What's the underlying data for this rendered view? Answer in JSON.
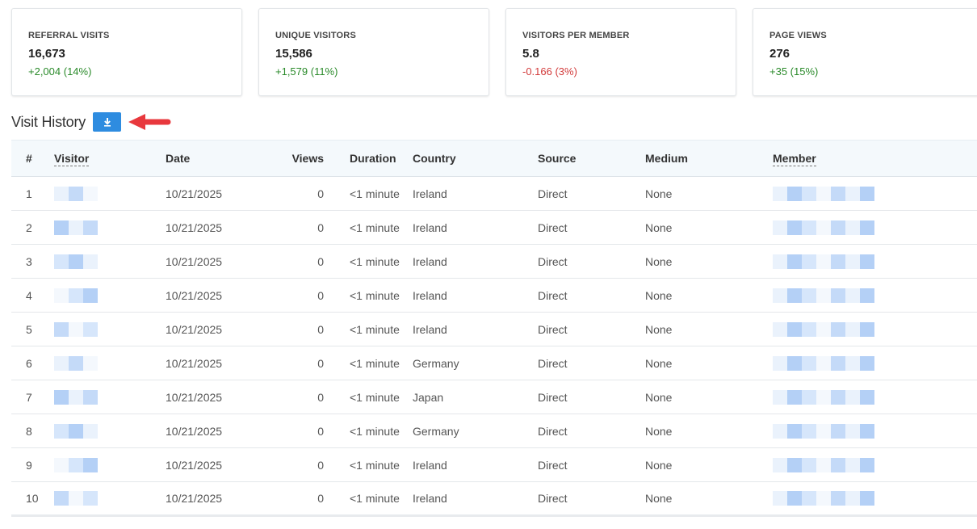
{
  "stats": [
    {
      "label": "REFERRAL VISITS",
      "value": "16,673",
      "change": "+2,004 (14%)",
      "trend": "positive"
    },
    {
      "label": "UNIQUE VISITORS",
      "value": "15,586",
      "change": "+1,579 (11%)",
      "trend": "positive"
    },
    {
      "label": "VISITORS PER MEMBER",
      "value": "5.8",
      "change": "-0.166 (3%)",
      "trend": "negative"
    },
    {
      "label": "PAGE VIEWS",
      "value": "276",
      "change": "+35 (15%)",
      "trend": "positive"
    }
  ],
  "section": {
    "title": "Visit History",
    "download_icon": "download-icon",
    "annotation_icon": "red-arrow-icon"
  },
  "table": {
    "headers": [
      "#",
      "Visitor",
      "Date",
      "Views",
      "Duration",
      "Country",
      "Source",
      "Medium",
      "Member"
    ],
    "rows": [
      {
        "num": "1",
        "date": "10/21/2025",
        "views": "0",
        "duration": "<1 minute",
        "country": "Ireland",
        "source": "Direct",
        "medium": "None"
      },
      {
        "num": "2",
        "date": "10/21/2025",
        "views": "0",
        "duration": "<1 minute",
        "country": "Ireland",
        "source": "Direct",
        "medium": "None"
      },
      {
        "num": "3",
        "date": "10/21/2025",
        "views": "0",
        "duration": "<1 minute",
        "country": "Ireland",
        "source": "Direct",
        "medium": "None"
      },
      {
        "num": "4",
        "date": "10/21/2025",
        "views": "0",
        "duration": "<1 minute",
        "country": "Ireland",
        "source": "Direct",
        "medium": "None"
      },
      {
        "num": "5",
        "date": "10/21/2025",
        "views": "0",
        "duration": "<1 minute",
        "country": "Ireland",
        "source": "Direct",
        "medium": "None"
      },
      {
        "num": "6",
        "date": "10/21/2025",
        "views": "0",
        "duration": "<1 minute",
        "country": "Germany",
        "source": "Direct",
        "medium": "None"
      },
      {
        "num": "7",
        "date": "10/21/2025",
        "views": "0",
        "duration": "<1 minute",
        "country": "Japan",
        "source": "Direct",
        "medium": "None"
      },
      {
        "num": "8",
        "date": "10/21/2025",
        "views": "0",
        "duration": "<1 minute",
        "country": "Germany",
        "source": "Direct",
        "medium": "None"
      },
      {
        "num": "9",
        "date": "10/21/2025",
        "views": "0",
        "duration": "<1 minute",
        "country": "Ireland",
        "source": "Direct",
        "medium": "None"
      },
      {
        "num": "10",
        "date": "10/21/2025",
        "views": "0",
        "duration": "<1 minute",
        "country": "Ireland",
        "source": "Direct",
        "medium": "None"
      }
    ]
  },
  "colors": {
    "accent": "#2e8ce0",
    "positive": "#2a8a2a",
    "negative": "#d23a3a",
    "annotation_arrow": "#e8383d",
    "header_bg": "#f4f9fc"
  }
}
